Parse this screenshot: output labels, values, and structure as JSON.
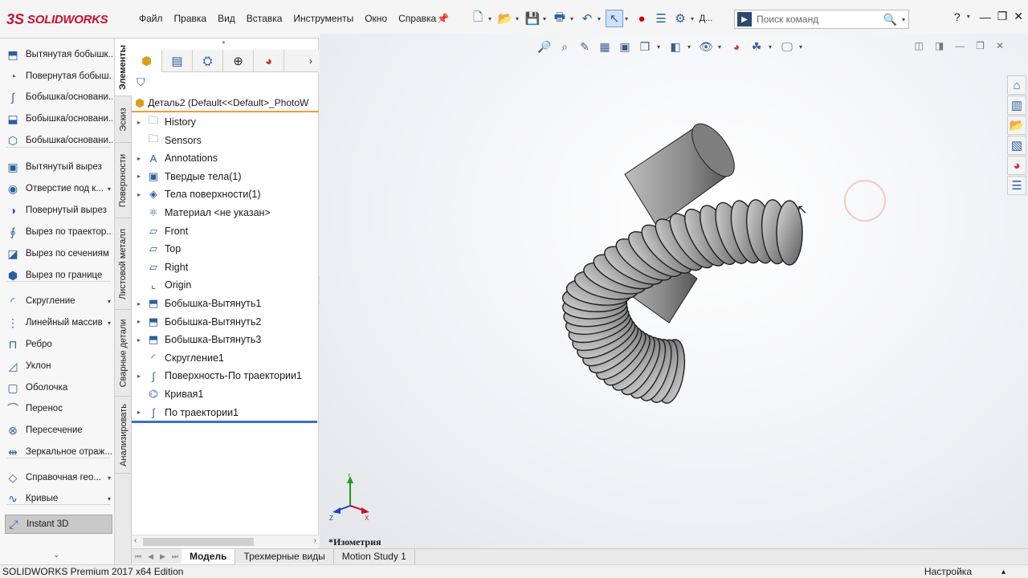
{
  "app": {
    "logo_mark": "3S",
    "logo_text": "SOLIDWORKS"
  },
  "menu": [
    "Файл",
    "Правка",
    "Вид",
    "Вставка",
    "Инструменты",
    "Окно",
    "Справка"
  ],
  "search": {
    "placeholder": "Поиск команд"
  },
  "toolbar": {
    "truncated_label": "Д..."
  },
  "help_label": "?",
  "commands": [
    {
      "label": "Вытянутая бобышк...",
      "icon": "extrude-boss-icon",
      "dropdown": false
    },
    {
      "label": "Повернутая бобыш...",
      "icon": "revolve-boss-icon",
      "dropdown": false
    },
    {
      "label": "Бобышка/основани...",
      "icon": "sweep-boss-icon",
      "dropdown": false
    },
    {
      "label": "Бобышка/основани...",
      "icon": "loft-boss-icon",
      "dropdown": false
    },
    {
      "label": "Бобышка/основани...",
      "icon": "boundary-boss-icon",
      "dropdown": false
    },
    {
      "label": "Вытянутый вырез",
      "icon": "extrude-cut-icon",
      "dropdown": false
    },
    {
      "label": "Отверстие под к...",
      "icon": "hole-wizard-icon",
      "dropdown": true
    },
    {
      "label": "Повернутый вырез",
      "icon": "revolve-cut-icon",
      "dropdown": false
    },
    {
      "label": "Вырез по траектор...",
      "icon": "sweep-cut-icon",
      "dropdown": false
    },
    {
      "label": "Вырез по сечениям",
      "icon": "loft-cut-icon",
      "dropdown": false
    },
    {
      "label": "Вырез по границе",
      "icon": "boundary-cut-icon",
      "dropdown": false
    },
    {
      "label": "Скругление",
      "icon": "fillet-icon",
      "dropdown": true
    },
    {
      "label": "Линейный массив",
      "icon": "linear-pattern-icon",
      "dropdown": true
    },
    {
      "label": "Ребро",
      "icon": "rib-icon",
      "dropdown": false
    },
    {
      "label": "Уклон",
      "icon": "draft-icon",
      "dropdown": false
    },
    {
      "label": "Оболочка",
      "icon": "shell-icon",
      "dropdown": false
    },
    {
      "label": "Перенос",
      "icon": "wrap-icon",
      "dropdown": false
    },
    {
      "label": "Пересечение",
      "icon": "intersect-icon",
      "dropdown": false
    },
    {
      "label": "Зеркальное отраж...",
      "icon": "mirror-icon",
      "dropdown": false
    },
    {
      "label": "Справочная гео...",
      "icon": "reference-geometry-icon",
      "dropdown": true
    },
    {
      "label": "Кривые",
      "icon": "curves-icon",
      "dropdown": true
    },
    {
      "label": "Instant 3D",
      "icon": "instant-3d-icon",
      "dropdown": false
    }
  ],
  "vtabs": [
    "Элементы",
    "Эскиз",
    "Поверхности",
    "Листовой металл",
    "Сварные детали",
    "Анализировать"
  ],
  "feature_tree": {
    "title": "Деталь2  (Default<<Default>_PhotoW",
    "items": [
      {
        "label": "History",
        "icon": "history-folder-icon",
        "expandable": true
      },
      {
        "label": "Sensors",
        "icon": "sensors-folder-icon",
        "expandable": false
      },
      {
        "label": "Annotations",
        "icon": "annotations-icon",
        "expandable": true
      },
      {
        "label": "Твердые тела(1)",
        "icon": "solid-bodies-icon",
        "expandable": true
      },
      {
        "label": "Тела поверхности(1)",
        "icon": "surface-bodies-icon",
        "expandable": true
      },
      {
        "label": "Материал <не указан>",
        "icon": "material-icon",
        "expandable": false
      },
      {
        "label": "Front",
        "icon": "plane-icon",
        "expandable": false
      },
      {
        "label": "Top",
        "icon": "plane-icon",
        "expandable": false
      },
      {
        "label": "Right",
        "icon": "plane-icon",
        "expandable": false
      },
      {
        "label": "Origin",
        "icon": "origin-icon",
        "expandable": false
      },
      {
        "label": "Бобышка-Вытянуть1",
        "icon": "boss-extrude-icon",
        "expandable": true
      },
      {
        "label": "Бобышка-Вытянуть2",
        "icon": "boss-extrude-icon",
        "expandable": true
      },
      {
        "label": "Бобышка-Вытянуть3",
        "icon": "boss-extrude-icon",
        "expandable": true
      },
      {
        "label": "Скругление1",
        "icon": "fillet-feature-icon",
        "expandable": false
      },
      {
        "label": "Поверхность-По траектории1",
        "icon": "surface-sweep-icon",
        "expandable": true
      },
      {
        "label": "Кривая1",
        "icon": "curve-feature-icon",
        "expandable": false
      },
      {
        "label": "По траектории1",
        "icon": "sweep-feature-icon",
        "expandable": true
      }
    ]
  },
  "viewport": {
    "view_label": "*Изометрия",
    "triad": {
      "y": "Y",
      "x": "X",
      "z": "Z"
    }
  },
  "bottom_tabs": [
    "Модель",
    "Трехмерные виды",
    "Motion Study 1"
  ],
  "status": {
    "edition": "SOLIDWORKS Premium 2017 x64 Edition",
    "right": "Настройка"
  }
}
